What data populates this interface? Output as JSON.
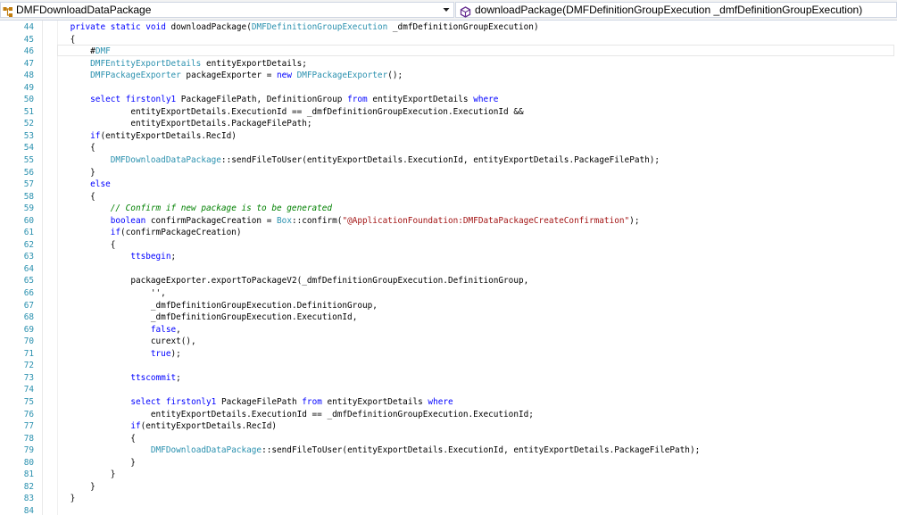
{
  "nav": {
    "class_dropdown": {
      "label": "DMFDownloadDataPackage",
      "icon": "class-icon"
    },
    "member_dropdown": {
      "label": "downloadPackage(DMFDefinitionGroupExecution _dmfDefinitionGroupExecution)",
      "icon": "method-icon"
    }
  },
  "editor": {
    "language": "X++",
    "lines": [
      {
        "number": "44",
        "code": "    private static void downloadPackage(DMFDefinitionGroupExecution _dmfDefinitionGroupExecution)"
      },
      {
        "number": "45",
        "code": "    {"
      },
      {
        "number": "46",
        "code": "        #DMF"
      },
      {
        "number": "47",
        "code": "        DMFEntityExportDetails entityExportDetails;"
      },
      {
        "number": "48",
        "code": "        DMFPackageExporter packageExporter = new DMFPackageExporter();"
      },
      {
        "number": "49",
        "code": ""
      },
      {
        "number": "50",
        "code": "        select firstonly1 PackageFilePath, DefinitionGroup from entityExportDetails where"
      },
      {
        "number": "51",
        "code": "                entityExportDetails.ExecutionId == _dmfDefinitionGroupExecution.ExecutionId &&"
      },
      {
        "number": "52",
        "code": "                entityExportDetails.PackageFilePath;"
      },
      {
        "number": "53",
        "code": "        if(entityExportDetails.RecId)"
      },
      {
        "number": "54",
        "code": "        {"
      },
      {
        "number": "55",
        "code": "            DMFDownloadDataPackage::sendFileToUser(entityExportDetails.ExecutionId, entityExportDetails.PackageFilePath);"
      },
      {
        "number": "56",
        "code": "        }"
      },
      {
        "number": "57",
        "code": "        else"
      },
      {
        "number": "58",
        "code": "        {"
      },
      {
        "number": "59",
        "code": "            // Confirm if new package is to be generated"
      },
      {
        "number": "60",
        "code": "            boolean confirmPackageCreation = Box::confirm(\"@ApplicationFoundation:DMFDataPackageCreateConfirmation\");"
      },
      {
        "number": "61",
        "code": "            if(confirmPackageCreation)"
      },
      {
        "number": "62",
        "code": "            {"
      },
      {
        "number": "63",
        "code": "                ttsbegin;"
      },
      {
        "number": "64",
        "code": ""
      },
      {
        "number": "65",
        "code": "                packageExporter.exportToPackageV2(_dmfDefinitionGroupExecution.DefinitionGroup,"
      },
      {
        "number": "66",
        "code": "                    '',"
      },
      {
        "number": "67",
        "code": "                    _dmfDefinitionGroupExecution.DefinitionGroup,"
      },
      {
        "number": "68",
        "code": "                    _dmfDefinitionGroupExecution.ExecutionId,"
      },
      {
        "number": "69",
        "code": "                    false,"
      },
      {
        "number": "70",
        "code": "                    curext(),"
      },
      {
        "number": "71",
        "code": "                    true);"
      },
      {
        "number": "72",
        "code": ""
      },
      {
        "number": "73",
        "code": "                ttscommit;"
      },
      {
        "number": "74",
        "code": ""
      },
      {
        "number": "75",
        "code": "                select firstonly1 PackageFilePath from entityExportDetails where"
      },
      {
        "number": "76",
        "code": "                    entityExportDetails.ExecutionId == _dmfDefinitionGroupExecution.ExecutionId;"
      },
      {
        "number": "77",
        "code": "                if(entityExportDetails.RecId)"
      },
      {
        "number": "78",
        "code": "                {"
      },
      {
        "number": "79",
        "code": "                    DMFDownloadDataPackage::sendFileToUser(entityExportDetails.ExecutionId, entityExportDetails.PackageFilePath);"
      },
      {
        "number": "80",
        "code": "                }"
      },
      {
        "number": "81",
        "code": "            }"
      },
      {
        "number": "82",
        "code": "        }"
      },
      {
        "number": "83",
        "code": "    }"
      },
      {
        "number": "84",
        "code": ""
      }
    ]
  }
}
